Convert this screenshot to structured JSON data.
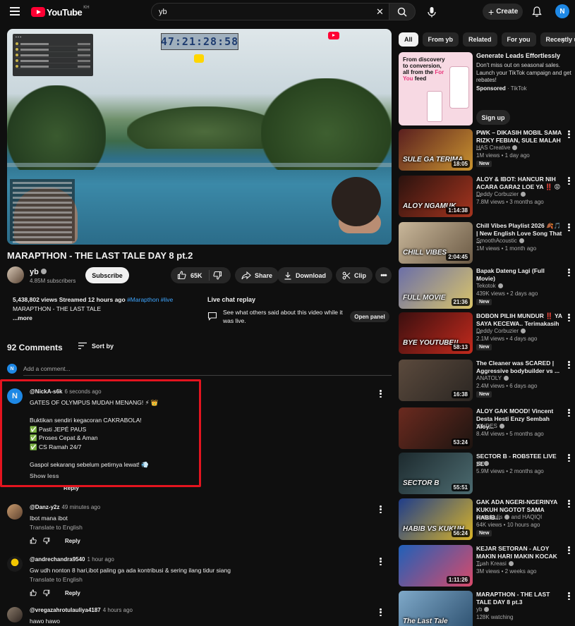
{
  "header": {
    "logo_text": "YouTube",
    "region": "KH",
    "search_value": "yb",
    "create_label": "Create",
    "avatar_letter": "N"
  },
  "player": {
    "timer": "47:21:28:58"
  },
  "video": {
    "title": "MARAPTHON - THE LAST TALE DAY 8 pt.2",
    "channel": "yb",
    "subscribers": "4.85M subscribers",
    "subscribe_label": "Subscribe",
    "likes": "65K",
    "share_label": "Share",
    "download_label": "Download",
    "clip_label": "Clip",
    "description": {
      "stats": "5,438,802 views  Streamed 12 hours ago",
      "tags": "#Marapthon #live",
      "line2": "MARAPTHON - THE LAST TALE",
      "more": "...more"
    },
    "live_chat": {
      "title": "Live chat replay",
      "text": "See what others said about this video while it was live.",
      "button": "Open panel"
    }
  },
  "comments": {
    "count_label": "92 Comments",
    "sort_label": "Sort by",
    "add_placeholder": "Add a comment...",
    "add_avatar": "N",
    "items": [
      {
        "author": "@NickA-s6k",
        "time": "6 seconds ago",
        "avatar_letter": "N",
        "lines": [
          "GATES OF OLYMPUS MUDAH MENANG! ⚡ 👑",
          "",
          "Buktikan sendiri kegacoran CAKRABOLA!",
          "✅ Pasti JEPÉ PAUS",
          "✅ Proses Cepat & Aman",
          "✅ CS Ramah 24/7",
          "",
          "Gaspol sekarang sebelum petirnya lewat! 💨"
        ],
        "show_less": "Show less",
        "reply": "Reply"
      },
      {
        "author": "@Danz-y2z",
        "time": "49 minutes ago",
        "text": "Ibot mana ibot",
        "translate": "Translate to English",
        "reply": "Reply"
      },
      {
        "author": "@andrechandra9540",
        "time": "1 hour ago",
        "text": "Gw udh nonton 8 hari,ibot paling ga ada kontribusi & sering ilang tidur siang",
        "translate": "Translate to English",
        "reply": "Reply"
      },
      {
        "author": "@vregazahrotulauliya4187",
        "time": "4 hours ago",
        "text": "hawo hawo"
      }
    ]
  },
  "sidebar": {
    "chips": [
      "All",
      "From yb",
      "Related",
      "For you",
      "Recently uploaded"
    ],
    "ad": {
      "thumb_text_a": "From discovery to conversion, all from the",
      "thumb_text_b": "For You",
      "thumb_text_c": "feed",
      "title": "Generate Leads Effortlessly",
      "description": "Don't miss out on seasonal sales. Launch your TikTok campaign and get rebates!",
      "sponsored": "Sponsored",
      "advertiser": "TikTok",
      "signup_label": "Sign up"
    },
    "items": [
      {
        "title": "PWK – DIKASIH MOBIL SAMA RIZKY FEBIAN, SULE MALAH ...",
        "channel": "HAS Creative",
        "stats": "1M views • 1 day ago",
        "badge": "New",
        "duration": "18:05",
        "thumb_text": "SULE GA TERIMA",
        "colors": [
          "#5a1f1f",
          "#c9932f"
        ]
      },
      {
        "title": "ALOY & IBOT: HANCUR NIH ACARA GARA2 LOE YA ‼️ 😡 ...",
        "channel": "Deddy Corbuzier",
        "stats": "7.8M views • 3 months ago",
        "duration": "1:14:38",
        "thumb_text": "ALOY NGAMUK",
        "colors": [
          "#2a120e",
          "#a6351f"
        ]
      },
      {
        "title": "Chill Vibes Playlist 2026 🍂🎵 | New English Love Song That ...",
        "channel": "SmoothAcoustic",
        "stats": "1M views • 1 month ago",
        "duration": "2:04:45",
        "thumb_text": "CHILL VIBES",
        "colors": [
          "#c9b79a",
          "#6b5a45"
        ]
      },
      {
        "title": "Bapak Dateng Lagi (Full Movie)",
        "channel": "Tekotok",
        "stats": "439K views • 2 days ago",
        "badge": "New",
        "duration": "21:36",
        "thumb_text": "FULL MOVIE",
        "colors": [
          "#6b6fa8",
          "#d9c46a"
        ]
      },
      {
        "title": "BOBON PILIH MUNDUR ‼️ YA SAYA KECEWA.. Terimakasih ...",
        "channel": "Deddy Corbuzier",
        "stats": "2.1M views • 4 days ago",
        "badge": "New",
        "duration": "58:13",
        "thumb_text": "BYE YOUTUBE!!",
        "colors": [
          "#3b0f0f",
          "#c22a1d"
        ]
      },
      {
        "title": "The Cleaner was SCARED | Aggressive bodybuilder vs ...",
        "channel": "ANATOLY",
        "stats": "2.4M views • 6 days ago",
        "badge": "New",
        "duration": "16:38",
        "thumb_text": "",
        "colors": [
          "#5b4a3d",
          "#2b2622"
        ]
      },
      {
        "title": "ALOY GAK MOOD! Vincent Desta Hesti Enzy Sembah Aloy...",
        "channel": "VINDES",
        "stats": "8.4M views • 5 months ago",
        "duration": "53:24",
        "thumb_text": "",
        "colors": [
          "#6b2a1f",
          "#1c1410"
        ]
      },
      {
        "title": "SECTOR B - ROBSTEE LIVE SET",
        "channel": "yb",
        "stats": "5.9M views • 2 months ago",
        "duration": "55:51",
        "thumb_text": "SECTOR B",
        "colors": [
          "#1d2a2e",
          "#4c6b70"
        ]
      },
      {
        "title": "GAK ADA NGERI-NGERINYA KUKUH NGOTOT SAMA HABIB...",
        "channel": "Jeda Nulis",
        "channel_extra": "and HAQIQI",
        "stats": "64K views • 10 hours ago",
        "badge": "New",
        "duration": "56:24",
        "thumb_text": "HABIB VS KUKUH",
        "colors": [
          "#1f3d8a",
          "#d8b328"
        ]
      },
      {
        "title": "KEJAR SETORAN - ALOY MAKIN HARI MAKIN KOCAK ...",
        "channel": "Tuah Kreasi",
        "stats": "3M views • 2 weeks ago",
        "duration": "1:11:26",
        "thumb_text": "",
        "colors": [
          "#2060b8",
          "#d94a6a"
        ]
      },
      {
        "title": "MARAPTHON - THE LAST TALE DAY 8 pt.3",
        "channel": "yb",
        "stats": "128K watching",
        "duration": "",
        "thumb_text": "The Last Tale",
        "colors": [
          "#7fa9c9",
          "#2c4f6e"
        ]
      }
    ]
  }
}
